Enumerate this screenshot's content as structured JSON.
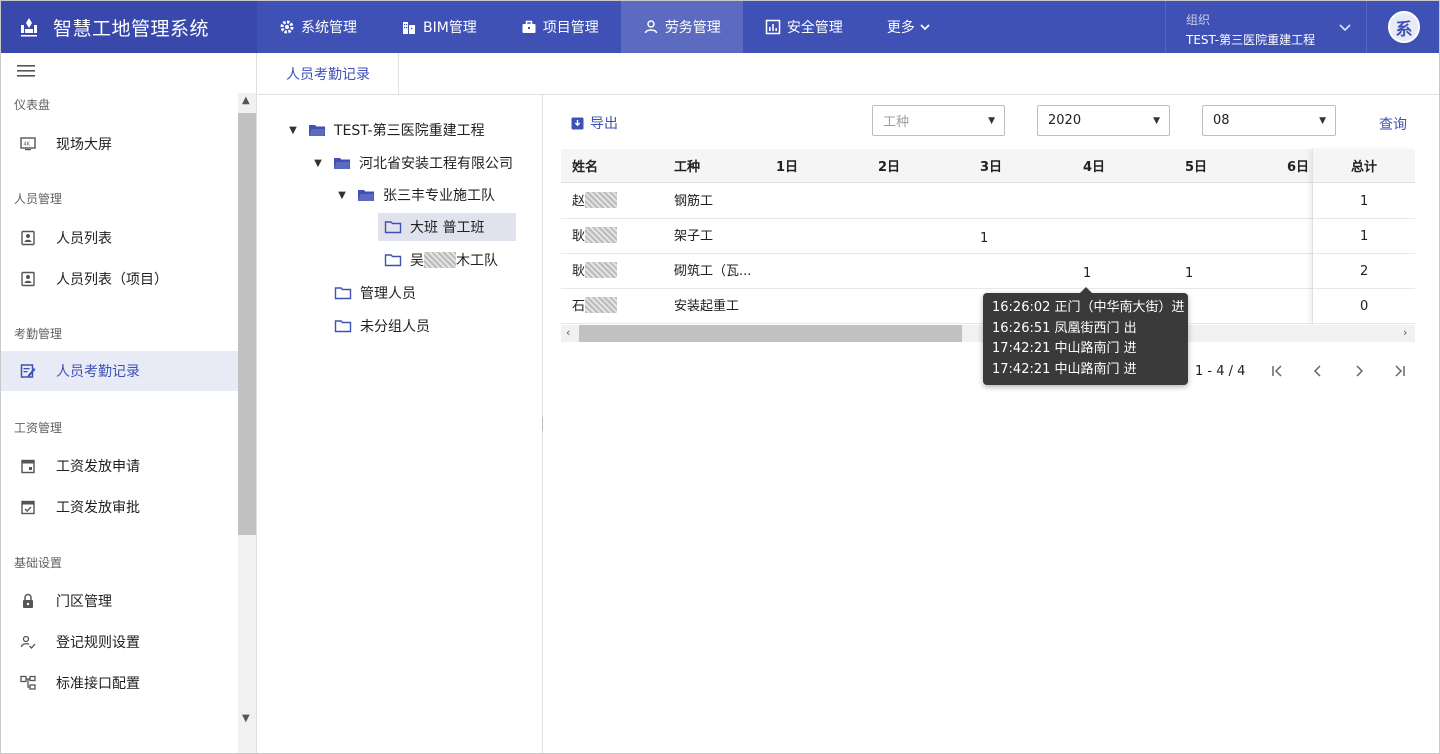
{
  "app": {
    "title": "智慧工地管理系统"
  },
  "nav": {
    "items": [
      {
        "label": "系统管理",
        "icon": "gear-icon"
      },
      {
        "label": "BIM管理",
        "icon": "building-icon"
      },
      {
        "label": "项目管理",
        "icon": "briefcase-icon"
      },
      {
        "label": "劳务管理",
        "icon": "person-icon",
        "active": true
      },
      {
        "label": "安全管理",
        "icon": "chart-icon"
      },
      {
        "label": "更多",
        "icon": "chevron-down-icon"
      }
    ],
    "org_label": "组织",
    "org_value": "TEST-第三医院重建工程",
    "avatar_text": "系"
  },
  "sidebar": {
    "sections": [
      {
        "title": "仪表盘",
        "items": [
          {
            "label": "现场大屏",
            "icon": "monitor-4k-icon"
          }
        ]
      },
      {
        "title": "人员管理",
        "items": [
          {
            "label": "人员列表",
            "icon": "badge-icon"
          },
          {
            "label": "人员列表（项目）",
            "icon": "badge-icon"
          }
        ]
      },
      {
        "title": "考勤管理",
        "items": [
          {
            "label": "人员考勤记录",
            "icon": "edit-note-icon",
            "active": true
          }
        ]
      },
      {
        "title": "工资管理",
        "items": [
          {
            "label": "工资发放申请",
            "icon": "calendar-icon"
          },
          {
            "label": "工资发放审批",
            "icon": "calendar-check-icon"
          }
        ]
      },
      {
        "title": "基础设置",
        "items": [
          {
            "label": "门区管理",
            "icon": "lock-icon"
          },
          {
            "label": "登记规则设置",
            "icon": "person-check-icon"
          },
          {
            "label": "标准接口配置",
            "icon": "hierarchy-icon"
          }
        ]
      }
    ]
  },
  "tabs": [
    {
      "label": "人员考勤记录"
    }
  ],
  "tree": {
    "nodes": [
      {
        "label": "TEST-第三医院重建工程",
        "expanded": true,
        "level": 0
      },
      {
        "label": "河北省安装工程有限公司",
        "expanded": true,
        "level": 1
      },
      {
        "label": "张三丰专业施工队",
        "expanded": true,
        "level": 2
      },
      {
        "label": "大班 普工班",
        "level": 3,
        "selected": true
      },
      {
        "label_prefix": "吴",
        "label_suffix": "木工队",
        "level": 3
      },
      {
        "label": "管理人员",
        "level": 1
      },
      {
        "label": "未分组人员",
        "level": 1
      }
    ]
  },
  "toolbar": {
    "export_label": "导出",
    "worktype_placeholder": "工种",
    "year_value": "2020",
    "month_value": "08",
    "query_label": "查询"
  },
  "table": {
    "headers": {
      "name": "姓名",
      "worktype": "工种",
      "d1": "1日",
      "d2": "2日",
      "d3": "3日",
      "d4": "4日",
      "d5": "5日",
      "d6": "6日",
      "total": "总计"
    },
    "rows": [
      {
        "name": "赵",
        "worktype": "钢筋工",
        "d3": "",
        "d4": "",
        "d5": "",
        "total": "1"
      },
      {
        "name": "耿",
        "worktype": "架子工",
        "d3": "1",
        "d4": "",
        "d5": "",
        "total": "1"
      },
      {
        "name": "耿",
        "worktype": "砌筑工（瓦...",
        "d3": "",
        "d4": "1",
        "d5": "1",
        "total": "2"
      },
      {
        "name": "石",
        "worktype": "安装起重工",
        "d3": "",
        "d4": "",
        "d5": "",
        "total": "0"
      }
    ]
  },
  "pagination": {
    "range": "1 - 4 / 4"
  },
  "tooltip": {
    "lines": [
      "16:26:02 正门（中华南大街）进",
      "16:26:51 凤凰街西门 出",
      "17:42:21 中山路南门 进",
      "17:42:21 中山路南门 进"
    ]
  },
  "colors": {
    "primary": "#3f51b5",
    "brand_bg": "#3949ab",
    "active_nav": "#5c6bc0",
    "active_side": "#e8eaf6"
  }
}
